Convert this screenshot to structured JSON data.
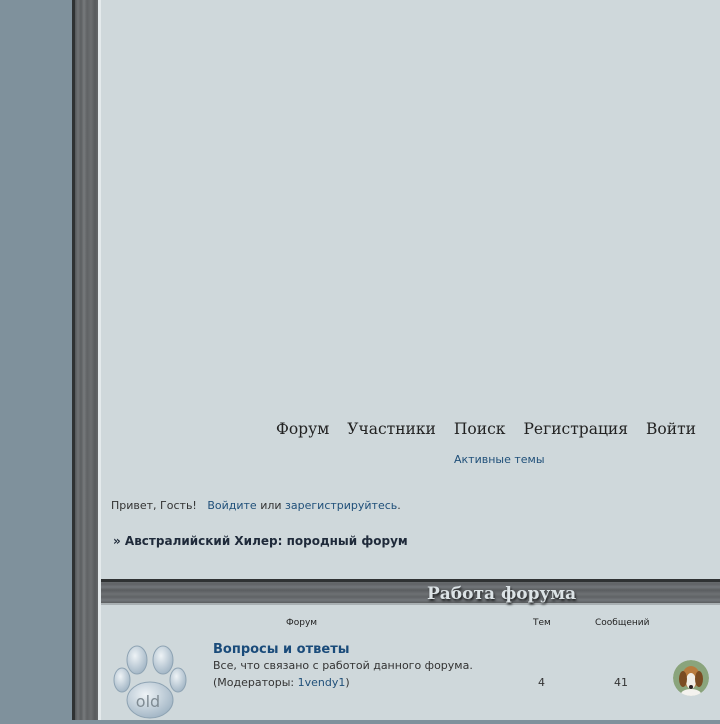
{
  "nav": {
    "items": [
      "Форум",
      "Участники",
      "Поиск",
      "Регистрация",
      "Войти"
    ],
    "active_topics": "Активные темы"
  },
  "greeting": {
    "prefix": "Привет, Гость!",
    "login": "Войдите",
    "or": "или",
    "register": "зарегистрируйтесь",
    "suffix": "."
  },
  "breadcrumb": "» Австралийский Хилер: породный форум",
  "category": {
    "title": "Работа форума",
    "columns": {
      "forum": "Форум",
      "topics": "Тем",
      "posts": "Сообщений"
    }
  },
  "forum": {
    "icon_text": "old",
    "title": "Вопросы и ответы",
    "description": "Все, что связано с работой данного форума.",
    "mods_prefix": "(Модераторы: ",
    "moderator": "1vendy1",
    "mods_suffix": ")",
    "topics": "4",
    "posts": "41"
  }
}
